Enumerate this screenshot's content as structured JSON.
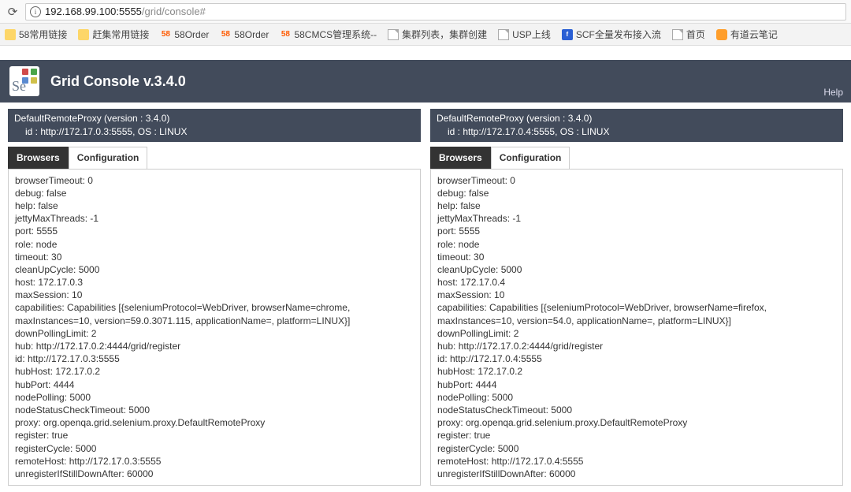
{
  "browser": {
    "url_host": "192.168.99.100",
    "url_port": ":5555",
    "url_path": "/grid/console#"
  },
  "bookmarks": [
    {
      "label": "58常用链接",
      "icon": "folder"
    },
    {
      "label": "赶集常用链接",
      "icon": "folder"
    },
    {
      "label": "58Order",
      "icon": "58"
    },
    {
      "label": "58Order",
      "icon": "58"
    },
    {
      "label": "58CMCS管理系统--",
      "icon": "58"
    },
    {
      "label": "集群列表，集群创建",
      "icon": "page"
    },
    {
      "label": "USP上线",
      "icon": "page"
    },
    {
      "label": "SCF全量发布接入流",
      "icon": "blue"
    },
    {
      "label": "首页",
      "icon": "page"
    },
    {
      "label": "有道云笔记",
      "icon": "orange"
    }
  ],
  "header": {
    "title": "Grid Console v.3.4.0",
    "help": "Help"
  },
  "tabs": {
    "browsers": "Browsers",
    "configuration": "Configuration"
  },
  "proxies": [
    {
      "header_line1": "DefaultRemoteProxy (version : 3.4.0)",
      "header_line2": "id : http://172.17.0.3:5555, OS : LINUX",
      "config": [
        "browserTimeout: 0",
        "debug: false",
        "help: false",
        "jettyMaxThreads: -1",
        "port: 5555",
        "role: node",
        "timeout: 30",
        "cleanUpCycle: 5000",
        "host: 172.17.0.3",
        "maxSession: 10",
        "capabilities: Capabilities [{seleniumProtocol=WebDriver, browserName=chrome, maxInstances=10, version=59.0.3071.115, applicationName=, platform=LINUX}]",
        "downPollingLimit: 2",
        "hub: http://172.17.0.2:4444/grid/register",
        "id: http://172.17.0.3:5555",
        "hubHost: 172.17.0.2",
        "hubPort: 4444",
        "nodePolling: 5000",
        "nodeStatusCheckTimeout: 5000",
        "proxy: org.openqa.grid.selenium.proxy.DefaultRemoteProxy",
        "register: true",
        "registerCycle: 5000",
        "remoteHost: http://172.17.0.3:5555",
        "unregisterIfStillDownAfter: 60000"
      ]
    },
    {
      "header_line1": "DefaultRemoteProxy (version : 3.4.0)",
      "header_line2": "id : http://172.17.0.4:5555, OS : LINUX",
      "config": [
        "browserTimeout: 0",
        "debug: false",
        "help: false",
        "jettyMaxThreads: -1",
        "port: 5555",
        "role: node",
        "timeout: 30",
        "cleanUpCycle: 5000",
        "host: 172.17.0.4",
        "maxSession: 10",
        "capabilities: Capabilities [{seleniumProtocol=WebDriver, browserName=firefox, maxInstances=10, version=54.0, applicationName=, platform=LINUX}]",
        "downPollingLimit: 2",
        "hub: http://172.17.0.2:4444/grid/register",
        "id: http://172.17.0.4:5555",
        "hubHost: 172.17.0.2",
        "hubPort: 4444",
        "nodePolling: 5000",
        "nodeStatusCheckTimeout: 5000",
        "proxy: org.openqa.grid.selenium.proxy.DefaultRemoteProxy",
        "register: true",
        "registerCycle: 5000",
        "remoteHost: http://172.17.0.4:5555",
        "unregisterIfStillDownAfter: 60000"
      ]
    }
  ]
}
